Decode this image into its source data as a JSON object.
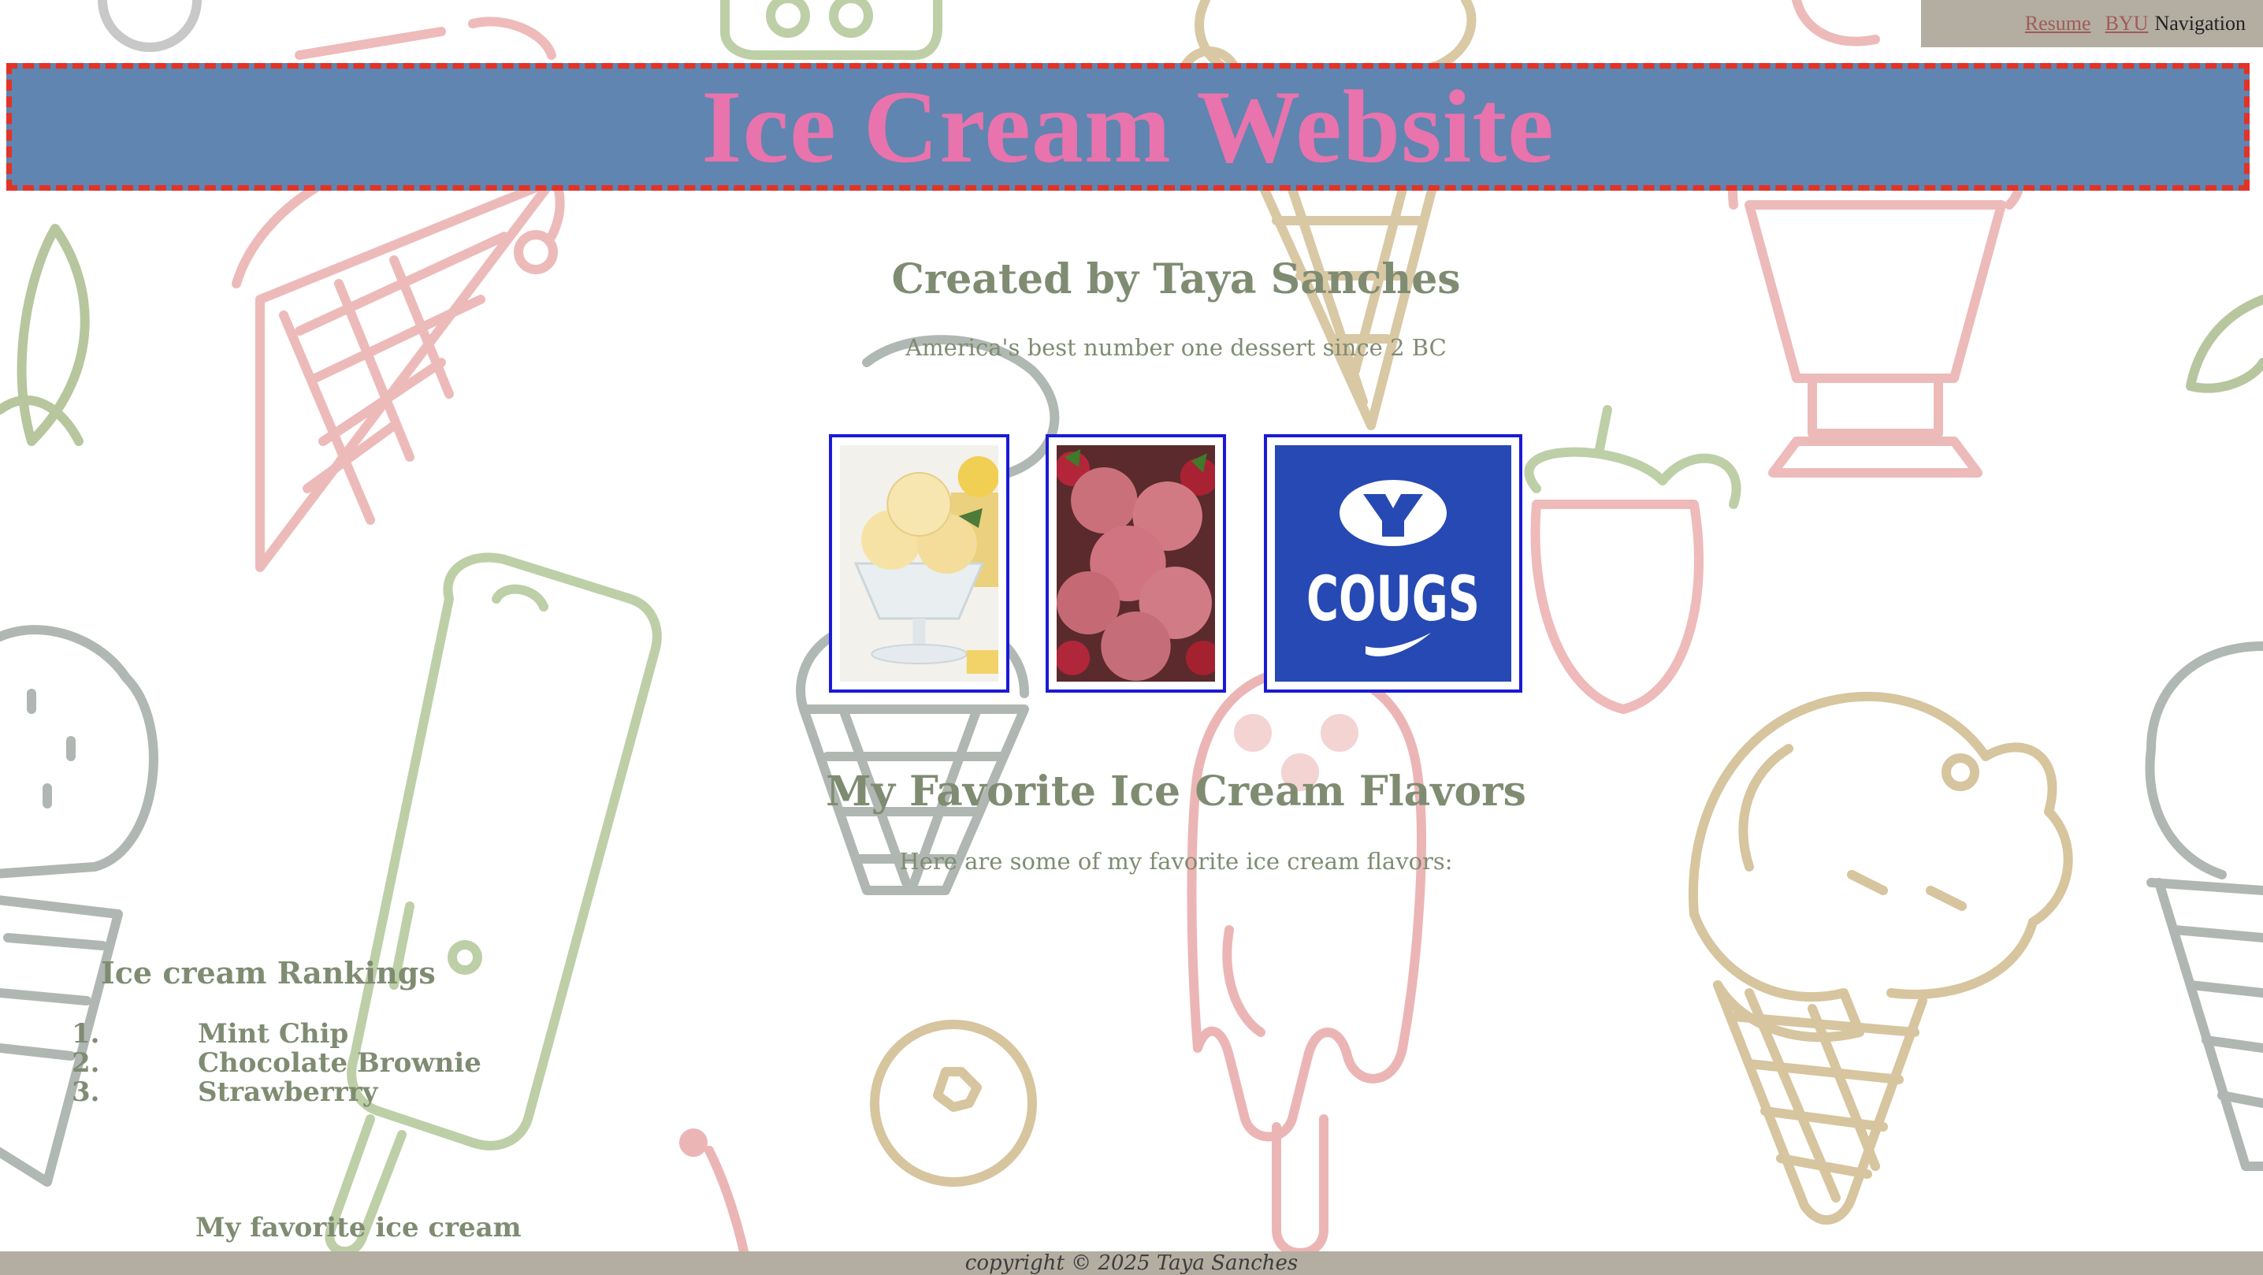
{
  "nav": {
    "resume_label": "Resume",
    "byu_label": "BYU",
    "navigation_label": "Navigation"
  },
  "header": {
    "title": "Ice Cream Website"
  },
  "intro": {
    "creator": "Created by Taya Sanches",
    "tagline": "America's best number one dessert since 2 BC"
  },
  "gallery": {
    "images": [
      {
        "name": "vanilla-sundae-image",
        "subject": "lemon vanilla ice cream sundae"
      },
      {
        "name": "strawberry-ice-cream-image",
        "subject": "strawberry ice cream scoops"
      },
      {
        "name": "byu-cougs-logo-image",
        "subject": "BYU Cougs logo",
        "logo_text": "COUGS",
        "logo_letter": "Y"
      }
    ]
  },
  "favorites": {
    "heading": "My Favorite Ice Cream Flavors",
    "intro": "Here are some of my favorite ice cream flavors:"
  },
  "rankings": {
    "title": "Ice cream Rankings",
    "items": [
      {
        "num": "1.",
        "label": "Mint Chip"
      },
      {
        "num": "2.",
        "label": "Chocolate Brownie"
      },
      {
        "num": "3.",
        "label": "Strawberrry"
      }
    ]
  },
  "my_favorite": {
    "label": "My favorite ice cream"
  },
  "footer": {
    "text": "copyright © 2025 Taya Sanches"
  },
  "colors": {
    "banner_bg": "#5f85b0",
    "banner_border": "#e33226",
    "title_pink": "#e873ad",
    "text_olive": "#7f8c72",
    "photo_border": "#1a1ad6",
    "footer_bg": "#b3aea1"
  }
}
